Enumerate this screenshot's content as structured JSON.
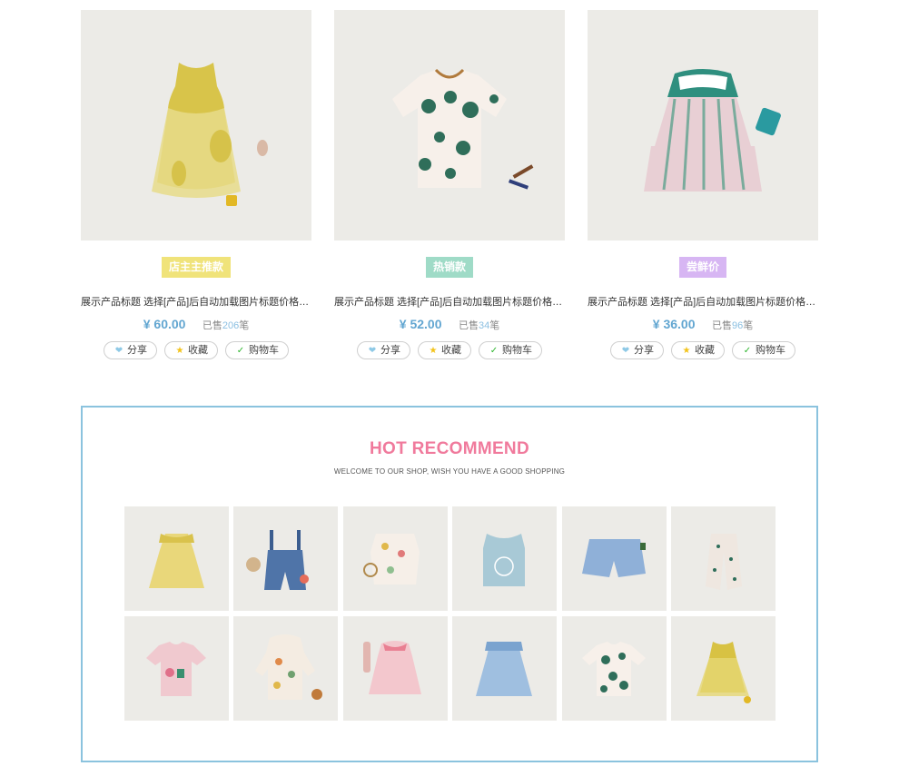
{
  "products": [
    {
      "badge": "店主主推款",
      "title": "展示产品标题 选择[产品]后自动加载图片标题价格等...",
      "price": "¥ 60.00",
      "sold_prefix": "已售",
      "sold_count": "206",
      "sold_suffix": "笔",
      "actions": {
        "share": "分享",
        "favorite": "收藏",
        "cart": "购物车"
      },
      "image_desc": "yellow-tulle-dress"
    },
    {
      "badge": "热销款",
      "title": "展示产品标题 选择[产品]后自动加载图片标题价格等...",
      "price": "¥ 52.00",
      "sold_prefix": "已售",
      "sold_count": "34",
      "sold_suffix": "笔",
      "actions": {
        "share": "分享",
        "favorite": "收藏",
        "cart": "购物车"
      },
      "image_desc": "polka-dot-tshirt"
    },
    {
      "badge": "尝鲜价",
      "title": "展示产品标题 选择[产品]后自动加载图片标题价格等...",
      "price": "¥ 36.00",
      "sold_prefix": "已售",
      "sold_count": "96",
      "sold_suffix": "笔",
      "actions": {
        "share": "分享",
        "favorite": "收藏",
        "cart": "购物车"
      },
      "image_desc": "striped-sailor-dress"
    }
  ],
  "recommend": {
    "title": "HOT RECOMMEND",
    "subtitle": "WELCOME TO OUR SHOP, WISH YOU HAVE A GOOD SHOPPING",
    "items": [
      "yellow-tutu-dress",
      "denim-overalls",
      "printed-romper",
      "blue-tank-top",
      "blue-shorts",
      "printed-pants",
      "pink-tshirt",
      "printed-jacket",
      "pink-dress",
      "blue-tulle-dress",
      "polka-dot-tshirt",
      "yellow-dress"
    ]
  },
  "colors": {
    "accent_blue": "#62a6d1",
    "recommend_title": "#f07a9c",
    "recommend_border": "#8bc3de",
    "badge_yellow": "#f0e37a",
    "badge_green": "#9fdbc7",
    "badge_purple": "#d7b6f3"
  }
}
